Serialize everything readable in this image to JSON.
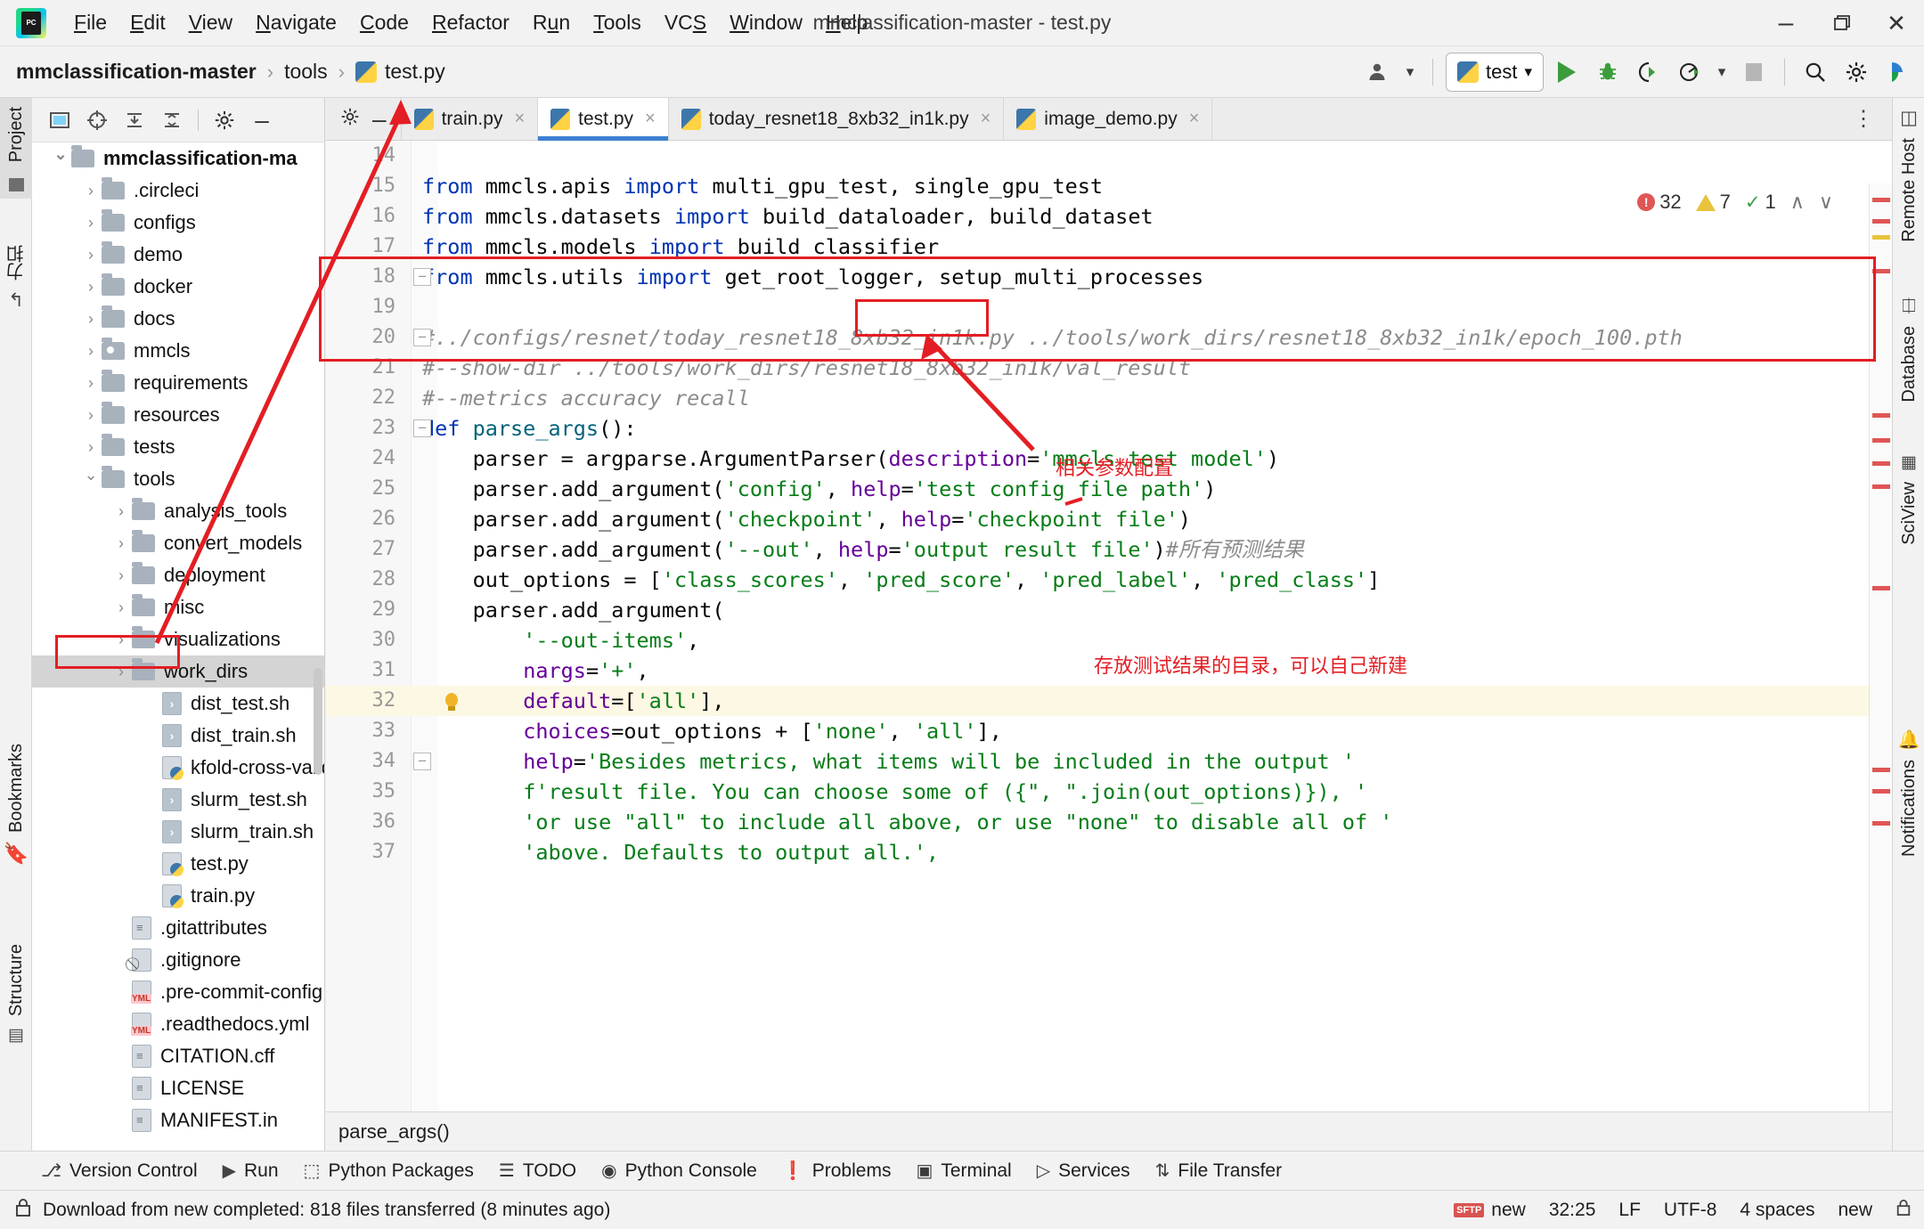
{
  "window": {
    "title": "mmclassification-master - test.py",
    "minimize": "–",
    "maximize": "❐",
    "close": "✕"
  },
  "menubar": {
    "logo_line1": "PC",
    "items": [
      {
        "label": "File",
        "accel": "F"
      },
      {
        "label": "Edit",
        "accel": "E"
      },
      {
        "label": "View",
        "accel": "V"
      },
      {
        "label": "Navigate",
        "accel": "N"
      },
      {
        "label": "Code",
        "accel": "C"
      },
      {
        "label": "Refactor",
        "accel": "R"
      },
      {
        "label": "Run",
        "accel": "u"
      },
      {
        "label": "Tools",
        "accel": "T"
      },
      {
        "label": "VCS",
        "accel": "S"
      },
      {
        "label": "Window",
        "accel": "W"
      },
      {
        "label": "Help",
        "accel": "H"
      }
    ]
  },
  "breadcrumb": {
    "items": [
      "mmclassification-master",
      "tools",
      "test.py"
    ],
    "separator": "›"
  },
  "toolbar": {
    "run_config_name": "test",
    "dropdown_caret": "▾",
    "run_label": "Run",
    "debug_label": "Debug",
    "coverage_label": "Run with Coverage",
    "profile_label": "Profile",
    "stop_label": "Stop",
    "search_label": "Search Everywhere",
    "settings_label": "Settings",
    "updates_label": "Updates"
  },
  "left_strip": {
    "project_tab": "Project",
    "bookmarks_tab": "Bookmarks",
    "structure_tab": "Structure",
    "cn_tab": "力扣"
  },
  "right_strip": {
    "remote_host_tab": "Remote Host",
    "database_tab": "Database",
    "sciview_tab": "SciView",
    "notifications_tab": "Notifications"
  },
  "project_panel": {
    "toolbar_buttons": [
      "select-opened-file",
      "scroll-from-source",
      "expand-all",
      "collapse-all",
      "settings",
      "hide"
    ],
    "tree": [
      {
        "label": "mmclassification-ma",
        "type": "folder",
        "indent": 0,
        "state": "open",
        "bold": true,
        "selected": false
      },
      {
        "label": ".circleci",
        "type": "folder",
        "indent": 1,
        "state": "closed",
        "bold": false,
        "selected": false
      },
      {
        "label": "configs",
        "type": "folder",
        "indent": 1,
        "state": "closed",
        "bold": false,
        "selected": false
      },
      {
        "label": "demo",
        "type": "folder",
        "indent": 1,
        "state": "closed",
        "bold": false,
        "selected": false
      },
      {
        "label": "docker",
        "type": "folder",
        "indent": 1,
        "state": "closed",
        "bold": false,
        "selected": false
      },
      {
        "label": "docs",
        "type": "folder",
        "indent": 1,
        "state": "closed",
        "bold": false,
        "selected": false
      },
      {
        "label": "mmcls",
        "type": "folder-src",
        "indent": 1,
        "state": "closed",
        "bold": false,
        "selected": false
      },
      {
        "label": "requirements",
        "type": "folder",
        "indent": 1,
        "state": "closed",
        "bold": false,
        "selected": false
      },
      {
        "label": "resources",
        "type": "folder",
        "indent": 1,
        "state": "closed",
        "bold": false,
        "selected": false
      },
      {
        "label": "tests",
        "type": "folder",
        "indent": 1,
        "state": "closed",
        "bold": false,
        "selected": false
      },
      {
        "label": "tools",
        "type": "folder",
        "indent": 1,
        "state": "open",
        "bold": false,
        "selected": false
      },
      {
        "label": "analysis_tools",
        "type": "folder",
        "indent": 2,
        "state": "closed",
        "bold": false,
        "selected": false
      },
      {
        "label": "convert_models",
        "type": "folder",
        "indent": 2,
        "state": "closed",
        "bold": false,
        "selected": false
      },
      {
        "label": "deployment",
        "type": "folder",
        "indent": 2,
        "state": "closed",
        "bold": false,
        "selected": false
      },
      {
        "label": "misc",
        "type": "folder",
        "indent": 2,
        "state": "closed",
        "bold": false,
        "selected": false
      },
      {
        "label": "visualizations",
        "type": "folder",
        "indent": 2,
        "state": "closed",
        "bold": false,
        "selected": false
      },
      {
        "label": "work_dirs",
        "type": "folder",
        "indent": 2,
        "state": "closed",
        "bold": false,
        "selected": true
      },
      {
        "label": "dist_test.sh",
        "type": "sh",
        "indent": 3,
        "state": "none",
        "bold": false,
        "selected": false
      },
      {
        "label": "dist_train.sh",
        "type": "sh",
        "indent": 3,
        "state": "none",
        "bold": false,
        "selected": false
      },
      {
        "label": "kfold-cross-valid",
        "type": "py",
        "indent": 3,
        "state": "none",
        "bold": false,
        "selected": false
      },
      {
        "label": "slurm_test.sh",
        "type": "sh",
        "indent": 3,
        "state": "none",
        "bold": false,
        "selected": false
      },
      {
        "label": "slurm_train.sh",
        "type": "sh",
        "indent": 3,
        "state": "none",
        "bold": false,
        "selected": false
      },
      {
        "label": "test.py",
        "type": "py",
        "indent": 3,
        "state": "none",
        "bold": false,
        "selected": false
      },
      {
        "label": "train.py",
        "type": "py",
        "indent": 3,
        "state": "none",
        "bold": false,
        "selected": false
      },
      {
        "label": ".gitattributes",
        "type": "txt",
        "indent": 2,
        "state": "none",
        "bold": false,
        "selected": false
      },
      {
        "label": ".gitignore",
        "type": "ign",
        "indent": 2,
        "state": "none",
        "bold": false,
        "selected": false
      },
      {
        "label": ".pre-commit-config",
        "type": "yml",
        "indent": 2,
        "state": "none",
        "bold": false,
        "selected": false
      },
      {
        "label": ".readthedocs.yml",
        "type": "yml",
        "indent": 2,
        "state": "none",
        "bold": false,
        "selected": false
      },
      {
        "label": "CITATION.cff",
        "type": "txt",
        "indent": 2,
        "state": "none",
        "bold": false,
        "selected": false
      },
      {
        "label": "LICENSE",
        "type": "txt",
        "indent": 2,
        "state": "none",
        "bold": false,
        "selected": false
      },
      {
        "label": "MANIFEST.in",
        "type": "txt",
        "indent": 2,
        "state": "none",
        "bold": false,
        "selected": false
      }
    ]
  },
  "editor": {
    "tabs": [
      {
        "label": "train.py",
        "active": false
      },
      {
        "label": "test.py",
        "active": true
      },
      {
        "label": "today_resnet18_8xb32_in1k.py",
        "active": false
      },
      {
        "label": "image_demo.py",
        "active": false
      }
    ],
    "close_glyph": "×",
    "inspection": {
      "errors": "32",
      "warnings": "7",
      "oks": "1",
      "up_arrow": "∧",
      "down_arrow": "∨"
    },
    "lines": [
      {
        "n": "14",
        "text": ""
      },
      {
        "n": "15",
        "tokens": [
          [
            "kw",
            "from "
          ],
          [
            "plain",
            "mmcls.apis "
          ],
          [
            "kw",
            "import "
          ],
          [
            "plain",
            "multi_gpu_test, single_gpu_test"
          ]
        ]
      },
      {
        "n": "16",
        "tokens": [
          [
            "kw",
            "from "
          ],
          [
            "plain",
            "mmcls.datasets "
          ],
          [
            "kw",
            "import "
          ],
          [
            "plain",
            "build_dataloader, build_dataset"
          ]
        ]
      },
      {
        "n": "17",
        "tokens": [
          [
            "kw",
            "from "
          ],
          [
            "plain",
            "mmcls.models "
          ],
          [
            "kw",
            "import "
          ],
          [
            "plain",
            "build_classifier"
          ]
        ]
      },
      {
        "n": "18",
        "tokens": [
          [
            "kw",
            "from "
          ],
          [
            "plain",
            "mmcls.utils "
          ],
          [
            "kw",
            "import "
          ],
          [
            "plain",
            "get_root_logger, setup_multi_processes"
          ]
        ]
      },
      {
        "n": "19",
        "tokens": []
      },
      {
        "n": "20",
        "tokens": [
          [
            "cmt",
            "#../configs/resnet/today_resnet18_8xb32_in1k.py ../tools/work_dirs/resnet18_8xb32_in1k/epoch_100.pth"
          ]
        ]
      },
      {
        "n": "21",
        "tokens": [
          [
            "cmt",
            "#--show-dir ../tools/work_dirs/resnet18_8xb32_in1k/val_result"
          ]
        ]
      },
      {
        "n": "22",
        "tokens": [
          [
            "cmt",
            "#--metrics accuracy recall"
          ]
        ]
      },
      {
        "n": "23",
        "tokens": [
          [
            "kw",
            "def "
          ],
          [
            "fn",
            "parse_args"
          ],
          [
            "plain",
            "():"
          ]
        ]
      },
      {
        "n": "24",
        "tokens": [
          [
            "plain",
            "    parser = argparse.ArgumentParser("
          ],
          [
            "param",
            "description"
          ],
          [
            "plain",
            "="
          ],
          [
            "str",
            "'mmcls test model'"
          ],
          [
            "plain",
            ")"
          ]
        ]
      },
      {
        "n": "25",
        "tokens": [
          [
            "plain",
            "    parser.add_argument("
          ],
          [
            "str",
            "'config'"
          ],
          [
            "plain",
            ", "
          ],
          [
            "param",
            "help"
          ],
          [
            "plain",
            "="
          ],
          [
            "str",
            "'test config file path'"
          ],
          [
            "plain",
            ")"
          ]
        ]
      },
      {
        "n": "26",
        "tokens": [
          [
            "plain",
            "    parser.add_argument("
          ],
          [
            "str",
            "'checkpoint'"
          ],
          [
            "plain",
            ", "
          ],
          [
            "param",
            "help"
          ],
          [
            "plain",
            "="
          ],
          [
            "str",
            "'checkpoint file'"
          ],
          [
            "plain",
            ")"
          ]
        ]
      },
      {
        "n": "27",
        "tokens": [
          [
            "plain",
            "    parser.add_argument("
          ],
          [
            "str",
            "'--out'"
          ],
          [
            "plain",
            ", "
          ],
          [
            "param",
            "help"
          ],
          [
            "plain",
            "="
          ],
          [
            "str",
            "'output result file'"
          ],
          [
            "plain",
            ")"
          ],
          [
            "cmt",
            "#所有预测结果"
          ]
        ]
      },
      {
        "n": "28",
        "tokens": [
          [
            "plain",
            "    out_options = ["
          ],
          [
            "str",
            "'class_scores'"
          ],
          [
            "plain",
            ", "
          ],
          [
            "str",
            "'pred_score'"
          ],
          [
            "plain",
            ", "
          ],
          [
            "str",
            "'pred_label'"
          ],
          [
            "plain",
            ", "
          ],
          [
            "str",
            "'pred_class'"
          ],
          [
            "plain",
            "]"
          ]
        ]
      },
      {
        "n": "29",
        "tokens": [
          [
            "plain",
            "    parser.add_argument("
          ]
        ]
      },
      {
        "n": "30",
        "tokens": [
          [
            "plain",
            "        "
          ],
          [
            "str",
            "'--out-items'"
          ],
          [
            "plain",
            ","
          ]
        ]
      },
      {
        "n": "31",
        "tokens": [
          [
            "plain",
            "        "
          ],
          [
            "param",
            "nargs"
          ],
          [
            "plain",
            "="
          ],
          [
            "str",
            "'+'"
          ],
          [
            "plain",
            ","
          ]
        ]
      },
      {
        "n": "32",
        "tokens": [
          [
            "plain",
            "        "
          ],
          [
            "param",
            "default"
          ],
          [
            "plain",
            "=["
          ],
          [
            "str",
            "'all'"
          ],
          [
            "plain",
            "],"
          ]
        ],
        "highlight": true
      },
      {
        "n": "33",
        "tokens": [
          [
            "plain",
            "        "
          ],
          [
            "param",
            "choices"
          ],
          [
            "plain",
            "=out_options + ["
          ],
          [
            "str",
            "'none'"
          ],
          [
            "plain",
            ", "
          ],
          [
            "str",
            "'all'"
          ],
          [
            "plain",
            "],"
          ]
        ]
      },
      {
        "n": "34",
        "tokens": [
          [
            "plain",
            "        "
          ],
          [
            "param",
            "help"
          ],
          [
            "plain",
            "="
          ],
          [
            "str",
            "'Besides metrics, what items will be included in the output '"
          ]
        ]
      },
      {
        "n": "35",
        "tokens": [
          [
            "plain",
            "        "
          ],
          [
            "str",
            "f'result file. You can choose some of ({\", \".join(out_options)}), '"
          ]
        ]
      },
      {
        "n": "36",
        "tokens": [
          [
            "plain",
            "        "
          ],
          [
            "str",
            "'or use \"all\" to include all above, or use \"none\" to disable all of '"
          ]
        ]
      },
      {
        "n": "37",
        "tokens": [
          [
            "plain",
            "        "
          ],
          [
            "str",
            "'above. Defaults to output all.',"
          ]
        ]
      }
    ],
    "bottom_breadcrumb": "parse_args()"
  },
  "annotations": {
    "note_params": "相关参数配置",
    "note_outdir": "存放测试结果的目录，可以自己新建",
    "accent_color": "#e31e24"
  },
  "tool_windows": {
    "items": [
      {
        "label": "Version Control",
        "icon": "branch-icon"
      },
      {
        "label": "Run",
        "icon": "play-icon"
      },
      {
        "label": "Python Packages",
        "icon": "package-icon"
      },
      {
        "label": "TODO",
        "icon": "list-icon"
      },
      {
        "label": "Python Console",
        "icon": "console-icon"
      },
      {
        "label": "Problems",
        "icon": "warning-icon"
      },
      {
        "label": "Terminal",
        "icon": "terminal-icon"
      },
      {
        "label": "Services",
        "icon": "services-icon"
      },
      {
        "label": "File Transfer",
        "icon": "transfer-icon"
      }
    ]
  },
  "statusbar": {
    "message": "Download from new completed: 818 files transferred (8 minutes ago)",
    "sftp_badge": "SFTP",
    "sftp_name": "new",
    "caret": "32:25",
    "line_sep": "LF",
    "encoding": "UTF-8",
    "indent": "4 spaces",
    "branch": "new",
    "lock_icon": "lock-icon"
  }
}
